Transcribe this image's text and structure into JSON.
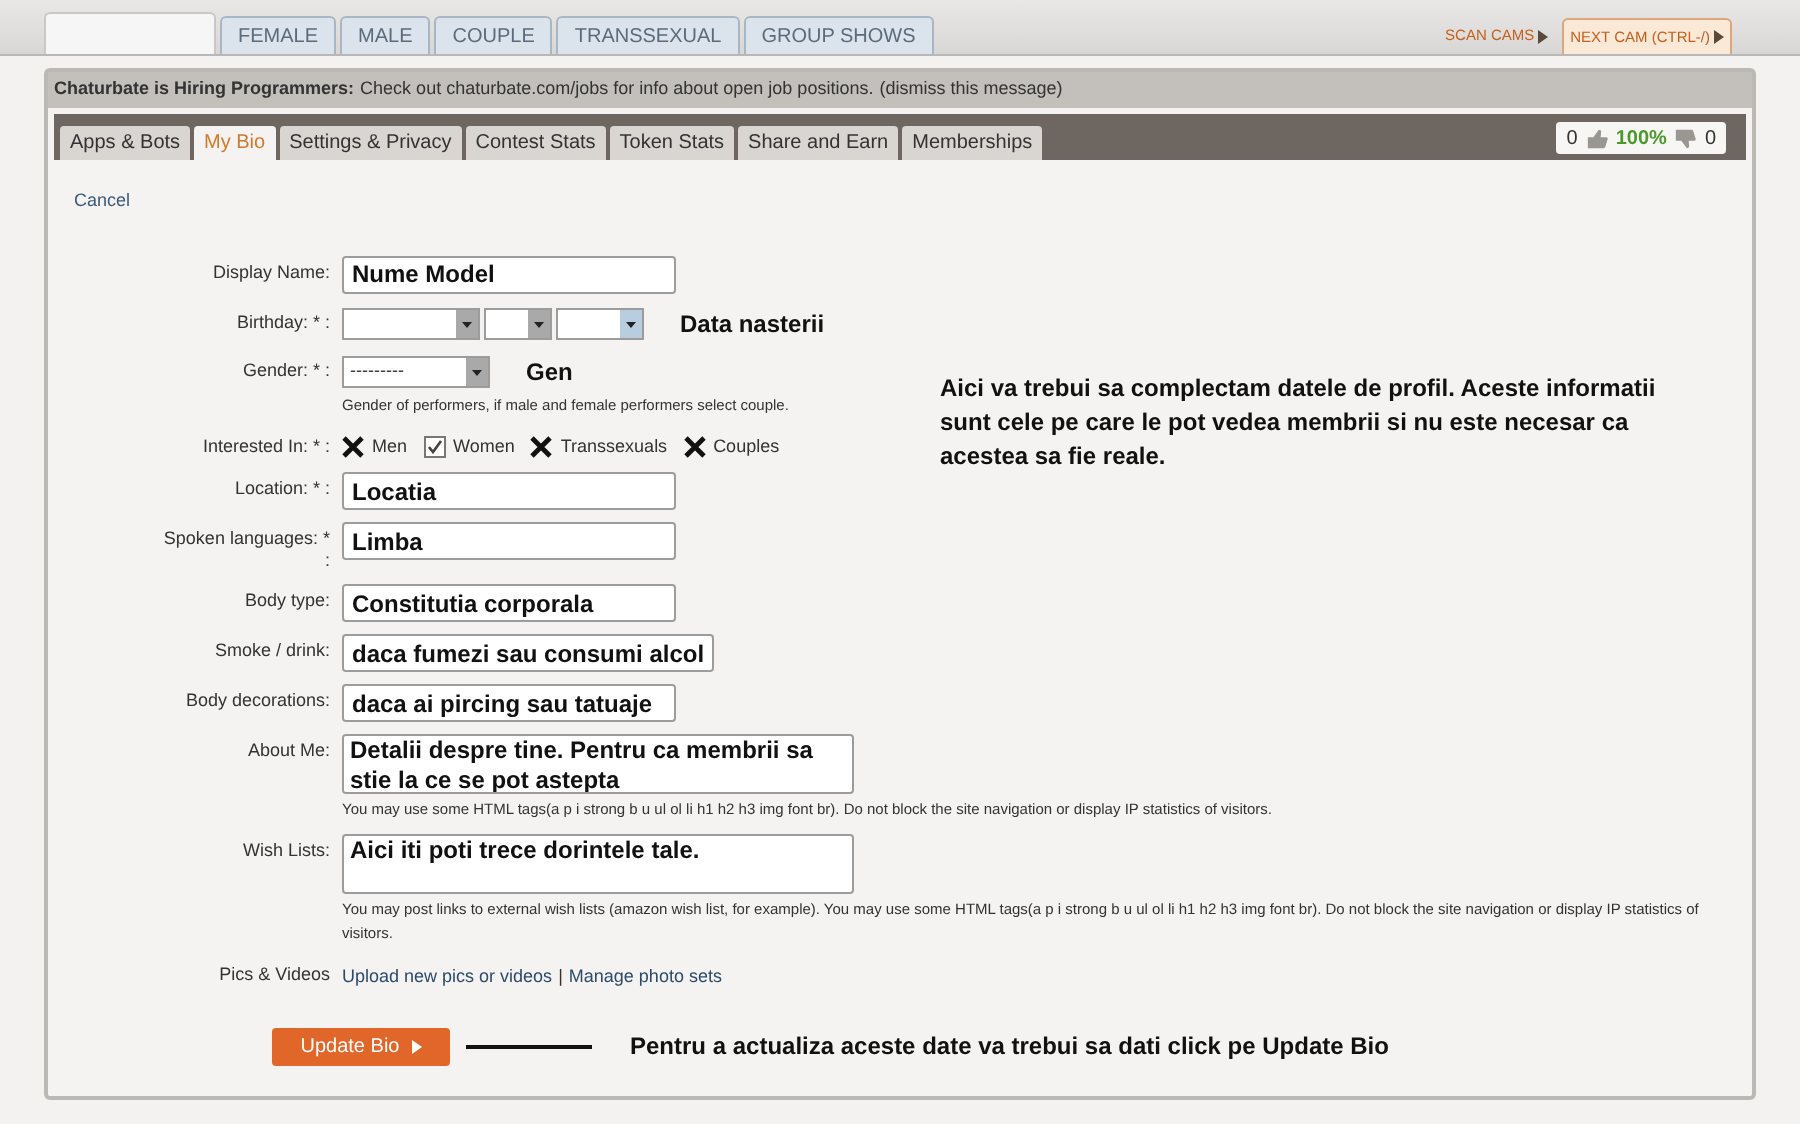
{
  "top_tabs": [
    {
      "label": "FEMALE"
    },
    {
      "label": "MALE"
    },
    {
      "label": "COUPLE"
    },
    {
      "label": "TRANSSEXUAL"
    },
    {
      "label": "GROUP SHOWS"
    }
  ],
  "cam_links": [
    {
      "label": "SCAN CAMS",
      "selected": false
    },
    {
      "label": "NEXT CAM (CTRL-/)",
      "selected": true
    }
  ],
  "notice": {
    "title": "Chaturbate is Hiring Programmers:",
    "text": "Check out chaturbate.com/jobs for info about open job positions.",
    "dismiss": "(dismiss this message)"
  },
  "tabs": [
    {
      "label": "Apps & Bots",
      "selected": false
    },
    {
      "label": "My Bio",
      "selected": true
    },
    {
      "label": "Settings & Privacy",
      "selected": false
    },
    {
      "label": "Contest Stats",
      "selected": false
    },
    {
      "label": "Token Stats",
      "selected": false
    },
    {
      "label": "Share and Earn",
      "selected": false
    },
    {
      "label": "Memberships",
      "selected": false
    }
  ],
  "rating": {
    "up": "0",
    "percent": "100%",
    "down": "0"
  },
  "cancel": "Cancel",
  "fields": [
    {
      "kind": "text",
      "label": "Display Name:",
      "value": "Nume Model"
    },
    {
      "kind": "date",
      "label": "Birthday: * :",
      "note": "Data nasterii"
    },
    {
      "kind": "select",
      "label": "Gender: * :",
      "value": "---------",
      "note": "Gen",
      "help": "Gender of performers, if male and female performers select couple."
    },
    {
      "kind": "checkboxes",
      "label": "Interested In: * :",
      "options": [
        {
          "label": "Men",
          "checked": false
        },
        {
          "label": "Women",
          "checked": true
        },
        {
          "label": "Transsexuals",
          "checked": false
        },
        {
          "label": "Couples",
          "checked": false
        }
      ]
    },
    {
      "kind": "text",
      "label": "Location: * :",
      "value": "Locatia"
    },
    {
      "kind": "text",
      "label": "Spoken languages: * :",
      "value": "Limba"
    },
    {
      "kind": "text",
      "label": "Body type:",
      "value": "Constitutia corporala"
    },
    {
      "kind": "text",
      "label": "Smoke / drink:",
      "value": "daca fumezi sau consumi alcol"
    },
    {
      "kind": "text",
      "label": "Body decorations:",
      "value": "daca ai pircing sau tatuaje"
    },
    {
      "kind": "textarea",
      "label": "About Me:",
      "value": "Detalii despre tine. Pentru ca membrii sa stie la ce se pot astepta",
      "help": "You may use some HTML tags(a p i strong b u ul ol li h1 h2 h3 img font br). Do not block the site navigation or display IP statistics of visitors."
    },
    {
      "kind": "textarea",
      "label": "Wish Lists:",
      "value": "Aici iti poti trece dorintele tale.",
      "help": "You may post links to external wish lists (amazon wish list, for example). You may use some HTML tags(a p i strong b u ul ol li h1 h2 h3 img font br). Do not block the site navigation or display IP statistics of visitors."
    },
    {
      "kind": "links",
      "label": "Pics & Videos",
      "links": [
        "Upload new pics or videos",
        "Manage photo sets"
      ],
      "separator": "|"
    }
  ],
  "side_note": "Aici va trebui sa complectam datele de profil.  Aceste informatii sunt cele pe care le pot vedea membrii si nu este necesar ca acestea sa fie reale.",
  "button": {
    "label": "Update Bio",
    "note": "Pentru a actualiza aceste date va trebui sa dati click pe Update Bio"
  }
}
